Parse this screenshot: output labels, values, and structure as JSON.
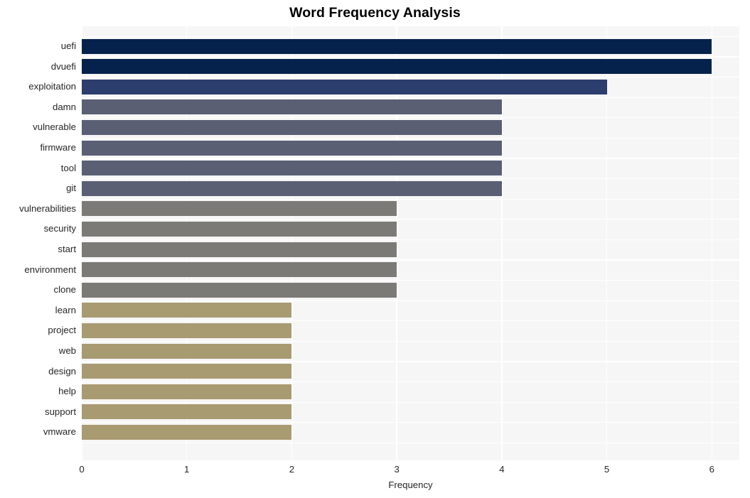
{
  "chart_data": {
    "type": "bar",
    "orientation": "horizontal",
    "title": "Word Frequency Analysis",
    "xlabel": "Frequency",
    "ylabel": "",
    "categories": [
      "uefi",
      "dvuefi",
      "exploitation",
      "damn",
      "vulnerable",
      "firmware",
      "tool",
      "git",
      "vulnerabilities",
      "security",
      "start",
      "environment",
      "clone",
      "learn",
      "project",
      "web",
      "design",
      "help",
      "support",
      "vmware"
    ],
    "values": [
      6,
      6,
      5,
      4,
      4,
      4,
      4,
      4,
      3,
      3,
      3,
      3,
      3,
      2,
      2,
      2,
      2,
      2,
      2,
      2
    ],
    "bar_colors": [
      "#04224c",
      "#04224c",
      "#2c3e6e",
      "#5a5f74",
      "#5a5f74",
      "#5a5f74",
      "#5a5f74",
      "#5a5f74",
      "#7b7a76",
      "#7b7a76",
      "#7b7a76",
      "#7b7a76",
      "#7b7a76",
      "#a89a71",
      "#a89a71",
      "#a89a71",
      "#a89a71",
      "#a89a71",
      "#a89a71",
      "#a89a71"
    ],
    "xlim": [
      0,
      6.262
    ],
    "ylim_categories": 20,
    "xticks": [
      0,
      1,
      2,
      3,
      4,
      5,
      6
    ],
    "xtick_labels": [
      "0",
      "1",
      "2",
      "3",
      "4",
      "5",
      "6"
    ],
    "grid": true,
    "grid_color": "#ffffff",
    "plot_background": "#f6f6f6",
    "figure_background": "#ffffff",
    "legend": null
  }
}
